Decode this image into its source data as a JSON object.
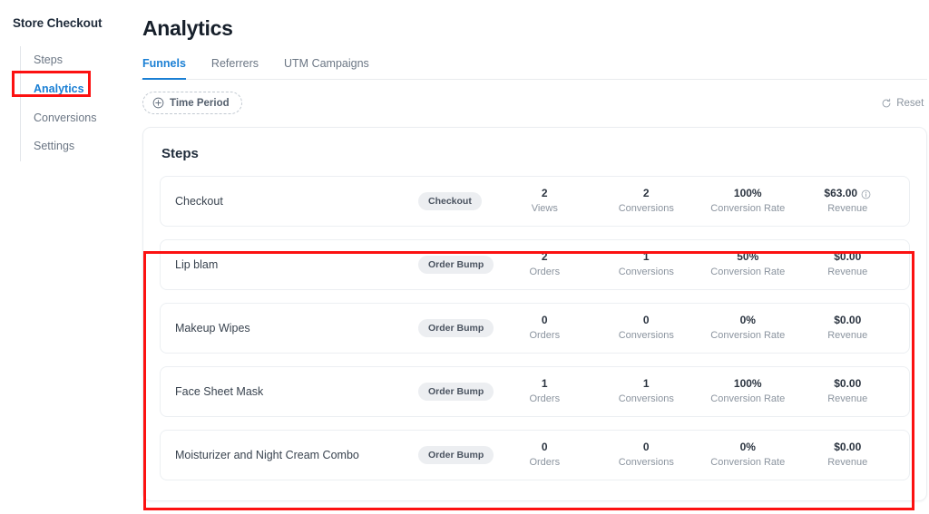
{
  "sidebar": {
    "store_title": "Store Checkout",
    "items": [
      {
        "label": "Steps",
        "active": false
      },
      {
        "label": "Analytics",
        "active": true
      },
      {
        "label": "Conversions",
        "active": false
      },
      {
        "label": "Settings",
        "active": false
      }
    ]
  },
  "header": {
    "title": "Analytics"
  },
  "tabs": [
    {
      "label": "Funnels",
      "active": true
    },
    {
      "label": "Referrers",
      "active": false
    },
    {
      "label": "UTM Campaigns",
      "active": false
    }
  ],
  "toolbar": {
    "time_period_label": "Time Period",
    "time_period_icon": "plus-circle-icon",
    "reset_label": "Reset",
    "reset_icon": "refresh-icon"
  },
  "card": {
    "title": "Steps",
    "rows": [
      {
        "name": "Checkout",
        "badge": "Checkout",
        "metrics": [
          {
            "value": "2",
            "label": "Views"
          },
          {
            "value": "2",
            "label": "Conversions"
          },
          {
            "value": "100%",
            "label": "Conversion Rate"
          },
          {
            "value": "$63.00",
            "label": "Revenue",
            "info_icon": true
          }
        ]
      },
      {
        "name": "Lip blam",
        "badge": "Order Bump",
        "metrics": [
          {
            "value": "2",
            "label": "Orders"
          },
          {
            "value": "1",
            "label": "Conversions"
          },
          {
            "value": "50%",
            "label": "Conversion Rate"
          },
          {
            "value": "$0.00",
            "label": "Revenue",
            "info_icon": false
          }
        ]
      },
      {
        "name": "Makeup Wipes",
        "badge": "Order Bump",
        "metrics": [
          {
            "value": "0",
            "label": "Orders"
          },
          {
            "value": "0",
            "label": "Conversions"
          },
          {
            "value": "0%",
            "label": "Conversion Rate"
          },
          {
            "value": "$0.00",
            "label": "Revenue",
            "info_icon": false
          }
        ]
      },
      {
        "name": "Face Sheet Mask",
        "badge": "Order Bump",
        "metrics": [
          {
            "value": "1",
            "label": "Orders"
          },
          {
            "value": "1",
            "label": "Conversions"
          },
          {
            "value": "100%",
            "label": "Conversion Rate"
          },
          {
            "value": "$0.00",
            "label": "Revenue",
            "info_icon": false
          }
        ]
      },
      {
        "name": "Moisturizer and Night Cream Combo",
        "badge": "Order Bump",
        "metrics": [
          {
            "value": "0",
            "label": "Orders"
          },
          {
            "value": "0",
            "label": "Conversions"
          },
          {
            "value": "0%",
            "label": "Conversion Rate"
          },
          {
            "value": "$0.00",
            "label": "Revenue",
            "info_icon": false
          }
        ]
      }
    ]
  },
  "annotations": {
    "accent_color": "#fc1111",
    "targets": [
      "sidebar-item-analytics",
      "order-bump-rows"
    ]
  },
  "colors": {
    "accent_blue": "#1a7fd4",
    "text_primary": "#1f2b3a",
    "text_muted": "#8b949f",
    "badge_bg": "#eceef1",
    "annotation_red": "#fc1111"
  }
}
